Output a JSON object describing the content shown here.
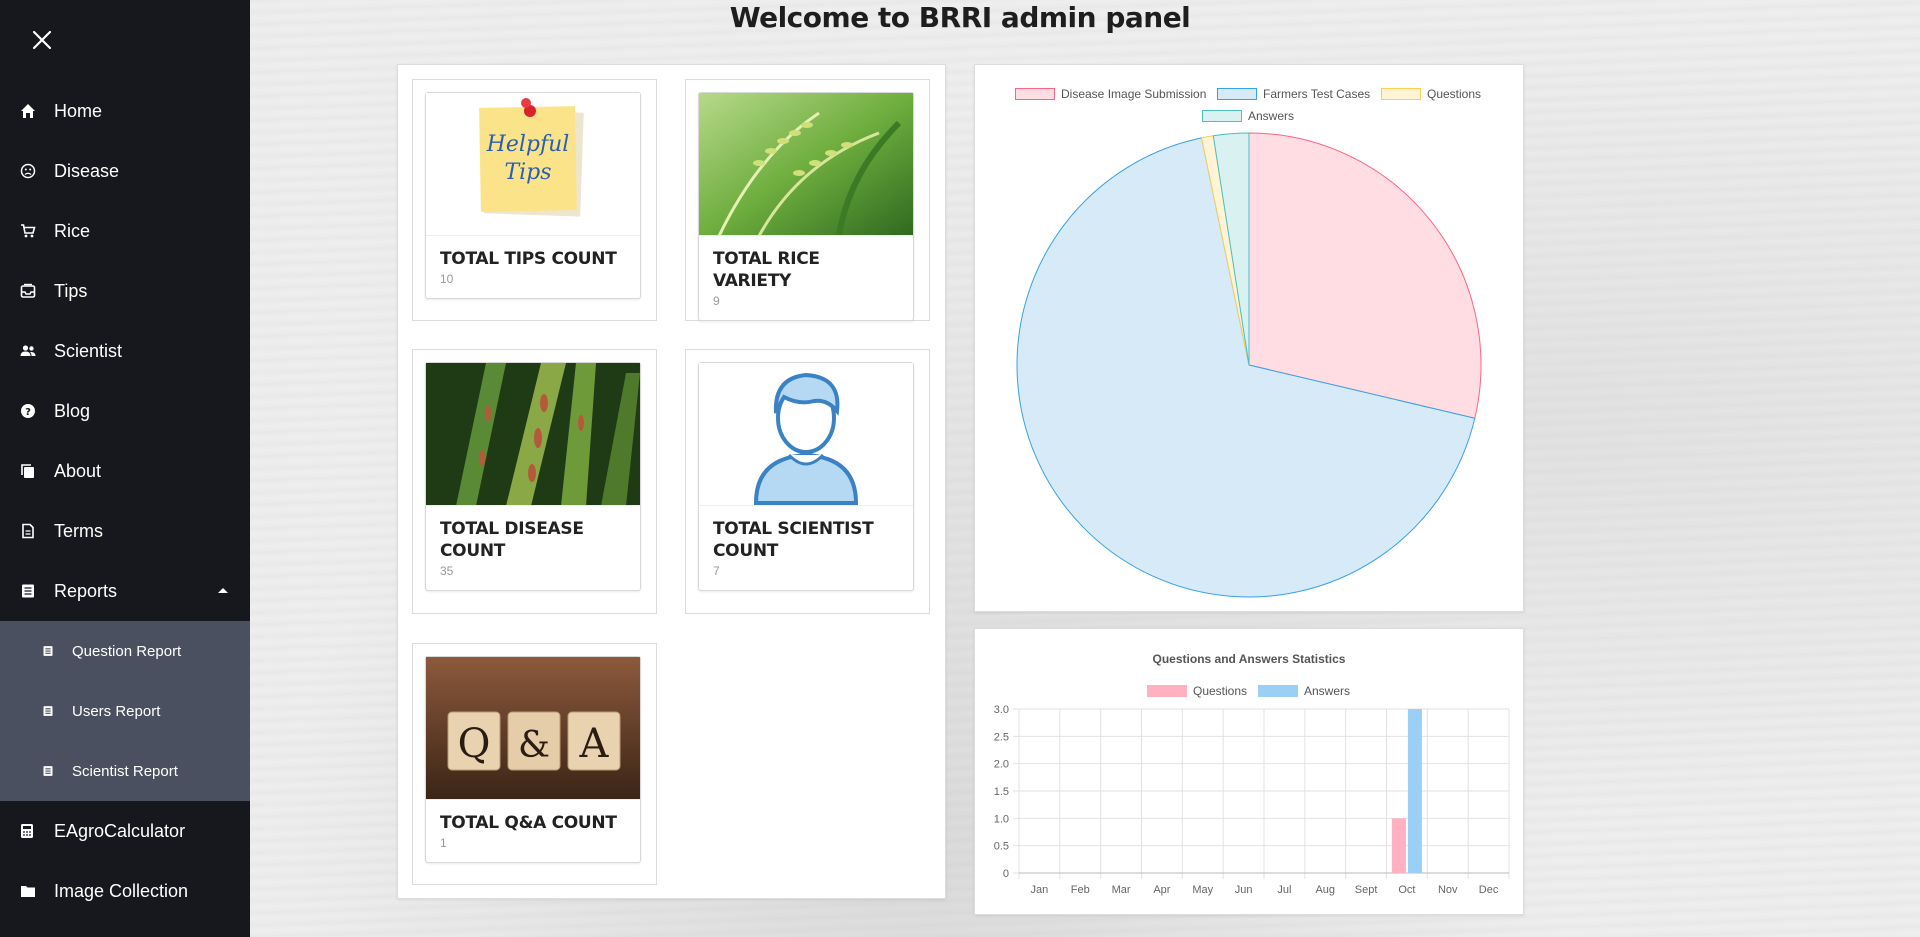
{
  "page": {
    "title": "Welcome to BRRI admin panel"
  },
  "sidebar": {
    "items": [
      {
        "label": "Home",
        "icon": "home-icon"
      },
      {
        "label": "Disease",
        "icon": "sad-face-icon"
      },
      {
        "label": "Rice",
        "icon": "cart-icon"
      },
      {
        "label": "Tips",
        "icon": "inbox-icon"
      },
      {
        "label": "Scientist",
        "icon": "people-icon"
      },
      {
        "label": "Blog",
        "icon": "question-icon"
      },
      {
        "label": "About",
        "icon": "copy-icon"
      },
      {
        "label": "Terms",
        "icon": "document-icon"
      },
      {
        "label": "Reports",
        "icon": "report-icon",
        "expanded": true
      }
    ],
    "report_subitems": [
      {
        "label": "Question Report"
      },
      {
        "label": "Users Report"
      },
      {
        "label": "Scientist Report"
      }
    ],
    "bottom_items": [
      {
        "label": "EAgroCalculator",
        "icon": "calculator-icon"
      },
      {
        "label": "Image Collection",
        "icon": "folder-icon"
      }
    ]
  },
  "cards": [
    {
      "title": "TOTAL TIPS COUNT",
      "value": "10",
      "image_text": "Helpful Tips"
    },
    {
      "title": "TOTAL RICE VARIETY",
      "value": "9"
    },
    {
      "title": "TOTAL DISEASE COUNT",
      "value": "35"
    },
    {
      "title": "TOTAL SCIENTIST COUNT",
      "value": "7"
    },
    {
      "title": "TOTAL Q&A COUNT",
      "value": "1",
      "image_text": [
        "Q",
        "&",
        "A"
      ]
    }
  ],
  "chart_data": [
    {
      "type": "pie",
      "labels": [
        "Disease Image Submission",
        "Farmers Test Cases",
        "Questions",
        "Answers"
      ],
      "values": [
        35,
        83,
        1,
        3
      ],
      "colors": {
        "fill": [
          "#ffdde3",
          "#d6eaf8",
          "#fff4d6",
          "#d9f1f0"
        ],
        "border": [
          "#ff6384",
          "#36a2eb",
          "#ffcd56",
          "#4bc0c0"
        ]
      },
      "legend": "top"
    },
    {
      "type": "bar",
      "title": "Questions and Answers Statistics",
      "categories": [
        "Jan",
        "Feb",
        "Mar",
        "Apr",
        "May",
        "Jun",
        "Jul",
        "Aug",
        "Sept",
        "Oct",
        "Nov",
        "Dec"
      ],
      "series": [
        {
          "name": "Questions",
          "values": [
            0,
            0,
            0,
            0,
            0,
            0,
            0,
            0,
            0,
            1,
            0,
            0
          ],
          "color": "#ffb1c1"
        },
        {
          "name": "Answers",
          "values": [
            0,
            0,
            0,
            0,
            0,
            0,
            0,
            0,
            0,
            3,
            0,
            0
          ],
          "color": "#9ad0f5"
        }
      ],
      "ylim": [
        0,
        3
      ],
      "yticks": [
        "0",
        "0.5",
        "1.0",
        "1.5",
        "2.0",
        "2.5",
        "3.0"
      ],
      "grid": true,
      "legend": "top"
    }
  ]
}
